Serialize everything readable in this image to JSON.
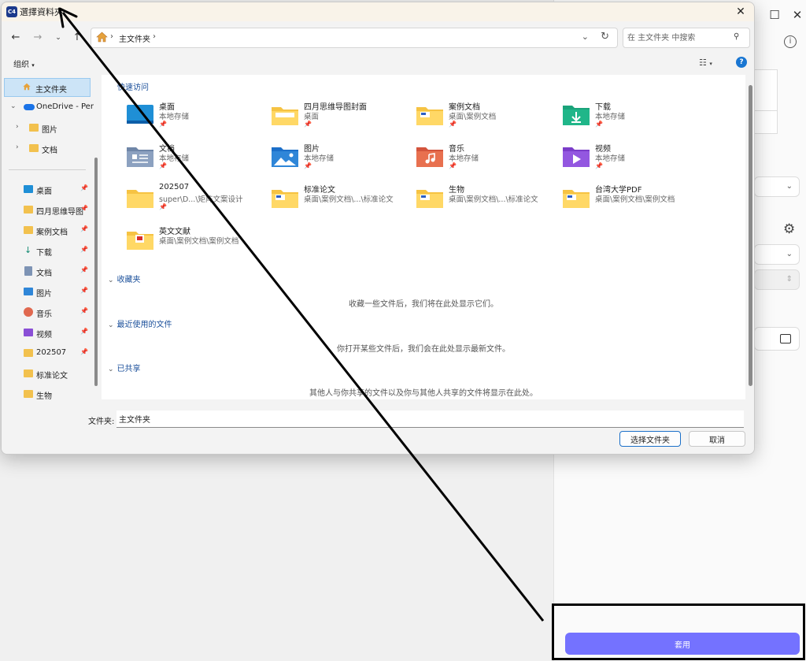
{
  "dialog": {
    "title": "選擇資料夾",
    "app_icon_text": "C4",
    "address": {
      "path": "主文件夹"
    },
    "search": {
      "placeholder": "在 主文件夹 中搜索"
    },
    "organize_label": "组织"
  },
  "nav": {
    "home": "主文件夹",
    "onedrive": "OneDrive - Per",
    "pictures": "图片",
    "documents": "文档",
    "quick": [
      {
        "label": "桌面"
      },
      {
        "label": "四月思维导图"
      },
      {
        "label": "案例文档"
      },
      {
        "label": "下载"
      },
      {
        "label": "文档"
      },
      {
        "label": "图片"
      },
      {
        "label": "音乐"
      },
      {
        "label": "视频"
      },
      {
        "label": "202507"
      },
      {
        "label": "标准论文"
      },
      {
        "label": "生物"
      }
    ]
  },
  "content": {
    "quick_access_title": "快速访问",
    "items": [
      {
        "name": "桌面",
        "sub": "本地存储"
      },
      {
        "name": "四月思维导图封面",
        "sub": "桌面"
      },
      {
        "name": "案例文档",
        "sub": "桌面\\案例文档"
      },
      {
        "name": "下载",
        "sub": "本地存储"
      },
      {
        "name": "文档",
        "sub": "本地存储"
      },
      {
        "name": "图片",
        "sub": "本地存储"
      },
      {
        "name": "音乐",
        "sub": "本地存储"
      },
      {
        "name": "视频",
        "sub": "本地存储"
      },
      {
        "name": "202507",
        "sub": "super\\D...\\矩阵文案设计"
      },
      {
        "name": "标准论文",
        "sub": "桌面\\案例文档\\...\\标准论文"
      },
      {
        "name": "生物",
        "sub": "桌面\\案例文档\\...\\标准论文"
      },
      {
        "name": "台湾大学PDF",
        "sub": "桌面\\案例文档\\案例文档"
      },
      {
        "name": "英文文献",
        "sub": "桌面\\案例文档\\案例文档"
      }
    ],
    "favorites_title": "收藏夹",
    "favorites_empty": "收藏一些文件后，我们将在此处显示它们。",
    "recent_title": "最近使用的文件",
    "recent_empty": "你打开某些文件后，我们会在此处显示最新文件。",
    "shared_title": "已共享",
    "shared_empty": "其他人与你共享的文件以及你与其他人共享的文件将显示在此处。"
  },
  "footer": {
    "folder_label": "文件夹:",
    "folder_value": "主文件夹",
    "select_button": "选择文件夹",
    "cancel_button": "取消"
  },
  "background": {
    "apply_button": "套用",
    "accent_color": "#7472ff"
  }
}
